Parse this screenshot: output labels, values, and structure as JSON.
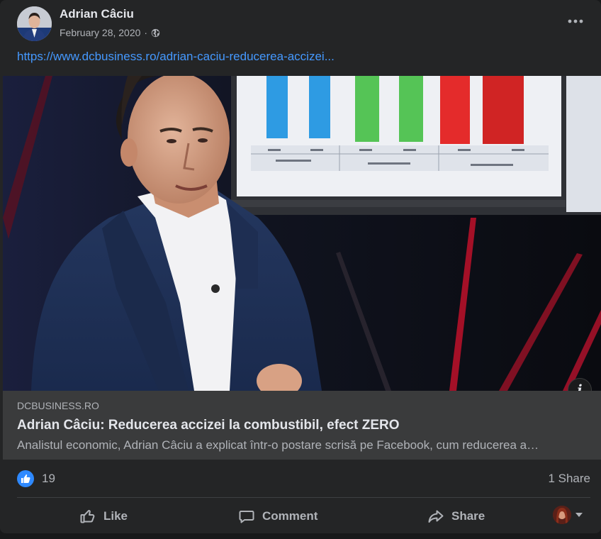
{
  "post": {
    "author": "Adrian Câciu",
    "date": "February 28, 2020",
    "separator": "·",
    "privacy_icon": "globe-icon",
    "link": "https://www.dcbusiness.ro/adrian-caciu-reducerea-accizei..."
  },
  "link_preview": {
    "domain": "DCBUSINESS.RO",
    "title": "Adrian Câciu: Reducerea accizei la combustibil, efect ZERO",
    "description": "Analistul economic, Adrian Câciu a explicat într-o postare scrisă pe Facebook, cum reducerea a…",
    "info_icon": "i"
  },
  "stats": {
    "reaction_icon": "like-reaction-icon",
    "reactions": "19",
    "shares": "1 Share"
  },
  "actions": {
    "like": "Like",
    "comment": "Comment",
    "share": "Share"
  },
  "colors": {
    "card": "#242526",
    "link": "#4599ff",
    "like_blue": "#2e89ff",
    "secondary_text": "#b0b3b8"
  }
}
